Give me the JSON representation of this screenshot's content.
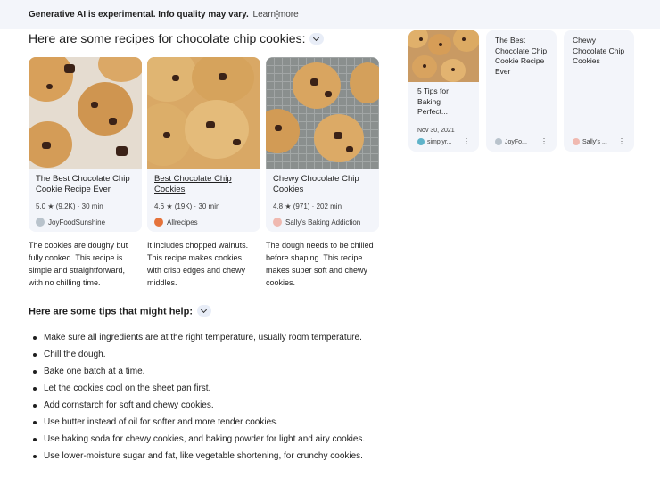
{
  "banner": {
    "text": "Generative AI is experimental. Info quality may vary.",
    "learn_more": "Learn more",
    "menu_icon": "more-vert-icon"
  },
  "heading": "Here are some recipes for chocolate chip cookies:",
  "recipes": [
    {
      "title": "The Best Chocolate Chip Cookie Recipe Ever",
      "rating": "5.0",
      "reviews": "(9.2K)",
      "time": "30 min",
      "source": "JoyFoodSunshine",
      "description": "The cookies are doughy but fully cooked. This recipe is simple and straightforward, with no chilling time."
    },
    {
      "title": "Best Chocolate Chip Cookies",
      "rating": "4.6",
      "reviews": "(19K)",
      "time": "30 min",
      "source": "Allrecipes",
      "description": "It includes chopped walnuts. This recipe makes cookies with crisp edges and chewy middles."
    },
    {
      "title": "Chewy Chocolate Chip Cookies",
      "rating": "4.8",
      "reviews": "(971)",
      "time": "202 min",
      "source": "Sally's Baking Addiction",
      "description": "The dough needs to be chilled before shaping. This recipe makes super soft and chewy cookies."
    }
  ],
  "side_cards": [
    {
      "title": "5 Tips for Baking Perfect...",
      "date": "Nov 30, 2021",
      "source": "simplyr..."
    },
    {
      "title": "The Best Chocolate Chip Cookie Recipe Ever",
      "source": "JoyFo..."
    },
    {
      "title": "Chewy Chocolate Chip Cookies",
      "source": "Sally's ..."
    }
  ],
  "tips_heading": "Here are some tips that might help:",
  "tips": [
    "Make sure all ingredients are at the right temperature, usually room temperature.",
    "Chill the dough.",
    "Bake one batch at a time.",
    "Let the cookies cool on the sheet pan first.",
    "Add cornstarch for soft and chewy cookies.",
    "Use butter instead of oil for softer and more tender cookies.",
    "Use baking soda for chewy cookies, and baking powder for light and airy cookies.",
    "Use lower-moisture sugar and fat, like vegetable shortening, for crunchy cookies."
  ],
  "colors": {
    "panel": "#f3f5fa",
    "text": "#1f1f1f",
    "muted": "#3c3c3c"
  }
}
